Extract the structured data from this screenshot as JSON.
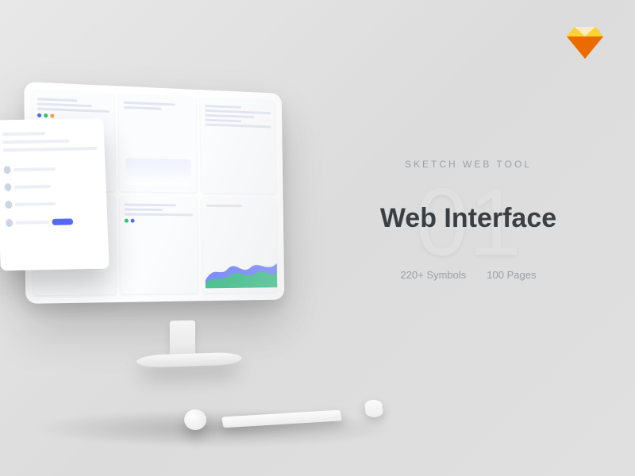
{
  "brand_icon": "sketch-diamond-icon",
  "eyebrow": "SKETCH WEB TOOL",
  "index_number": "01",
  "title": "Web Interface",
  "stats": {
    "symbols": "220+ Symbols",
    "pages": "100 Pages"
  },
  "colors": {
    "accent_blue": "#5468ff",
    "accent_green": "#28c76f",
    "accent_orange": "#ff9f43",
    "text_dark": "#3a3f44",
    "text_muted": "#9aa0a6"
  }
}
